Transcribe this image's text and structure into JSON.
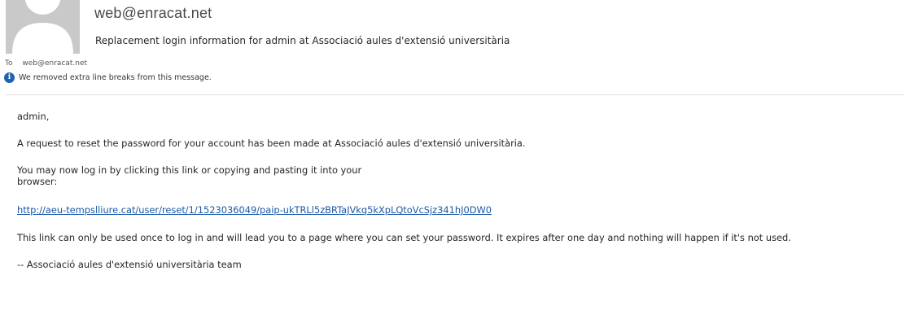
{
  "header": {
    "sender": "web@enracat.net",
    "subject": "Replacement login information for admin at Associació aules d'extensió universitària",
    "to_label": "To",
    "to_address": "web@enracat.net",
    "notice": "We removed extra line breaks from this message."
  },
  "icons": {
    "avatar": "person-avatar-icon",
    "info": "info-icon"
  },
  "colors": {
    "link": "#1a59a8",
    "info_icon": "#1f64b3",
    "avatar_bg": "#c9c9c9"
  },
  "body": {
    "greeting": "admin,",
    "request": "A request to reset the password for your account has been made at Associació aules d'extensió universitària.",
    "may_line1": "You may now log in by clicking this link or copying and pasting it into your",
    "may_line2": "browser:",
    "link": "http://aeu-tempslliure.cat/user/reset/1/1523036049/paip-ukTRLl5zBRTaJVkq5kXpLQtoVcSjz341hJ0DW0",
    "expire": "This link can only be used once to log in and will lead you to a page where you can set your password. It expires after one day and nothing will happen if it's not used.",
    "signature": "-- Associació aules d'extensió universitària team"
  }
}
